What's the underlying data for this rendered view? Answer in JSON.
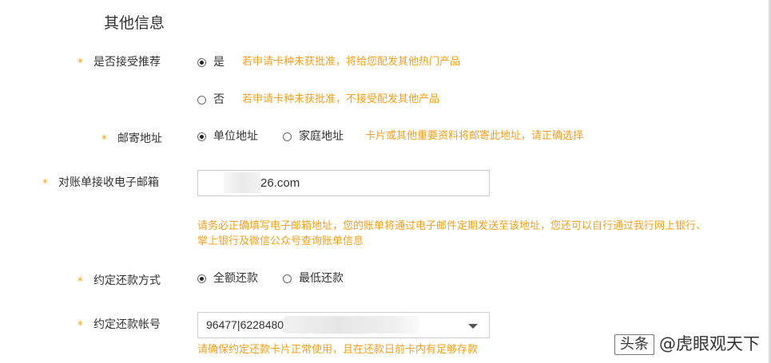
{
  "section": {
    "title": "其他信息"
  },
  "required_mark": "*",
  "recommend": {
    "label": "是否接受推荐",
    "options": [
      {
        "label": "是",
        "hint": "若申请卡种未获批准，将给您配发其他热门产品",
        "checked": true
      },
      {
        "label": "否",
        "hint": "若申请卡种未获批准，不接受配发其他产品",
        "checked": false
      }
    ]
  },
  "mail_address": {
    "label": "邮寄地址",
    "options": [
      {
        "label": "单位地址",
        "checked": true
      },
      {
        "label": "家庭地址",
        "checked": false
      }
    ],
    "hint": "卡片或其他重要资料将邮寄此地址，请正确选择"
  },
  "email": {
    "label": "对账单接收电子邮箱",
    "value_visible": "26.com",
    "hint_line1": "请务必正确填写电子邮箱地址，您的账单将通过电子邮件定期发送至该地址，您还可以自行通过我行网上银行、",
    "hint_line2": "掌上银行及微信公众号查询账单信息"
  },
  "repay_method": {
    "label": "约定还款方式",
    "options": [
      {
        "label": "全额还款",
        "checked": true
      },
      {
        "label": "最低还款",
        "checked": false
      }
    ]
  },
  "repay_account": {
    "label": "约定还款帐号",
    "value_visible": "96477|6228480",
    "hint": "请确保约定还款卡片正常使用，且在还款日前卡内有足够存款"
  },
  "watermark": {
    "box_text": "头条",
    "text": "@虎眼观天下"
  }
}
